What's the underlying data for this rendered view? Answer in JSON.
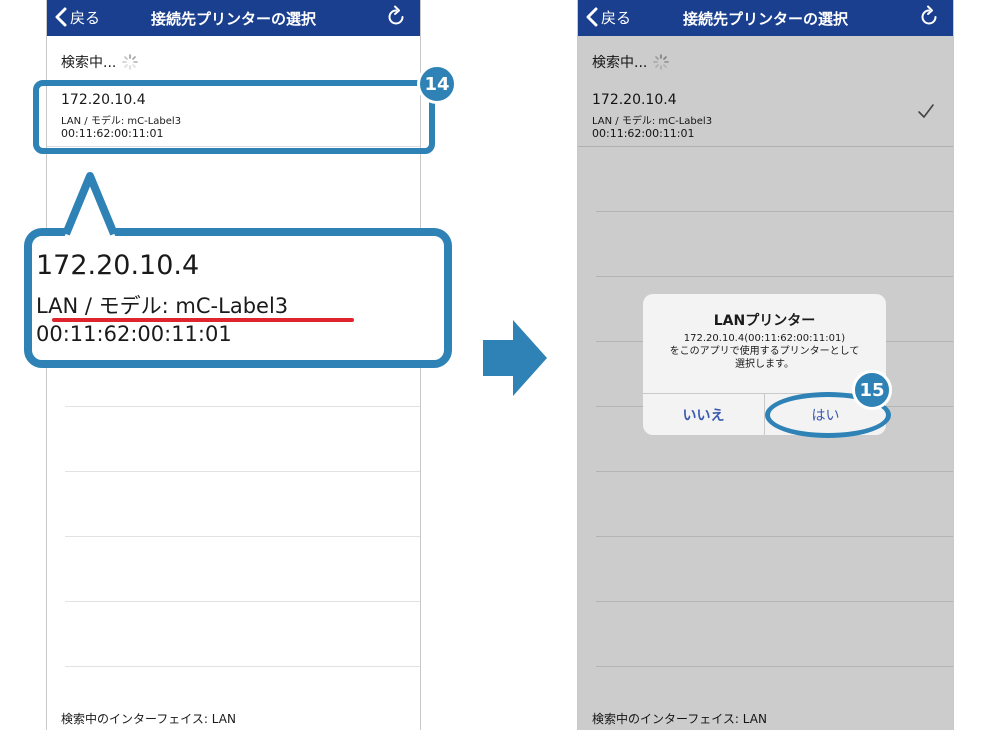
{
  "colors": {
    "nav_bar": "#1a3f8f",
    "accent": "#2e82b5",
    "underline": "#e0242e",
    "dialog_button": "#3b5bb0"
  },
  "nav": {
    "back_label": "戻る",
    "title": "接続先プリンターの選択",
    "refresh_icon": "refresh-icon"
  },
  "searching_label": "検索中...",
  "device": {
    "ip": "172.20.10.4",
    "model": "LAN / モデル: mC-Label3",
    "mac": "00:11:62:00:11:01"
  },
  "footer": "検索中のインターフェイス: LAN",
  "callout": {
    "ip": "172.20.10.4",
    "model": "LAN / モデル: mC-Label3",
    "mac": "00:11:62:00:11:01"
  },
  "steps": {
    "first": "14",
    "second": "15"
  },
  "dialog": {
    "title": "LANプリンター",
    "line1": "172.20.10.4(00:11:62:00:11:01)",
    "line2": "をこのアプリで使用するプリンターとして",
    "line3": "選択します。",
    "no_label": "いいえ",
    "yes_label": "はい"
  }
}
